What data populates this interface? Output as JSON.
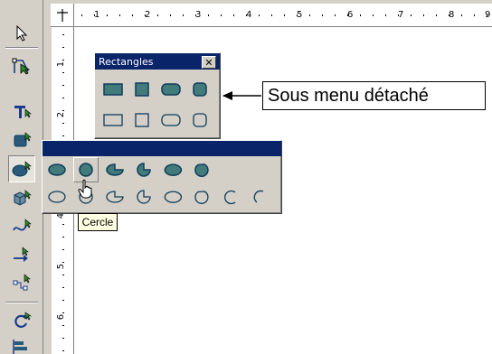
{
  "ruler": {
    "horizontal_numbers": [
      "1",
      "2",
      "3",
      "4",
      "5",
      "6",
      "7",
      "8",
      "9"
    ],
    "vertical_numbers": [
      "1",
      "2",
      "3",
      "4",
      "5",
      "6"
    ]
  },
  "toolbar": {
    "items": [
      {
        "name": "select-tool",
        "icon": "arrow-pointer-icon",
        "pressed": false
      },
      {
        "name": "points-tool",
        "icon": "edit-points-icon",
        "pressed": false
      },
      {
        "name": "text-tool",
        "icon": "text-t-icon",
        "pressed": false
      },
      {
        "name": "rectangles-tool",
        "icon": "rectangle-icon",
        "pressed": false
      },
      {
        "name": "ellipses-tool",
        "icon": "ellipse-icon",
        "pressed": true
      },
      {
        "name": "3d-objects-tool",
        "icon": "cube-icon",
        "pressed": false
      },
      {
        "name": "curves-tool",
        "icon": "curve-icon",
        "pressed": false
      },
      {
        "name": "lines-tool",
        "icon": "arrow-line-icon",
        "pressed": false
      },
      {
        "name": "connectors-tool",
        "icon": "connector-icon",
        "pressed": false
      },
      {
        "name": "rotate-tool",
        "icon": "rotate-icon",
        "pressed": false
      },
      {
        "name": "align-tool",
        "icon": "align-icon",
        "pressed": false
      }
    ]
  },
  "rect_palette": {
    "title": "Rectangles",
    "close_symbol": "✕"
  },
  "ellipse_palette": {
    "hover_index": 1
  },
  "callout": {
    "text": "Sous menu détaché"
  },
  "tooltip": {
    "text": "Cercle"
  },
  "colors": {
    "face": "#d4d0c8",
    "title_bar": "#0a246a",
    "shape_fill": "#427b7b",
    "shape_stroke": "#0f3c5a",
    "tooltip_bg": "#ffffe1"
  }
}
